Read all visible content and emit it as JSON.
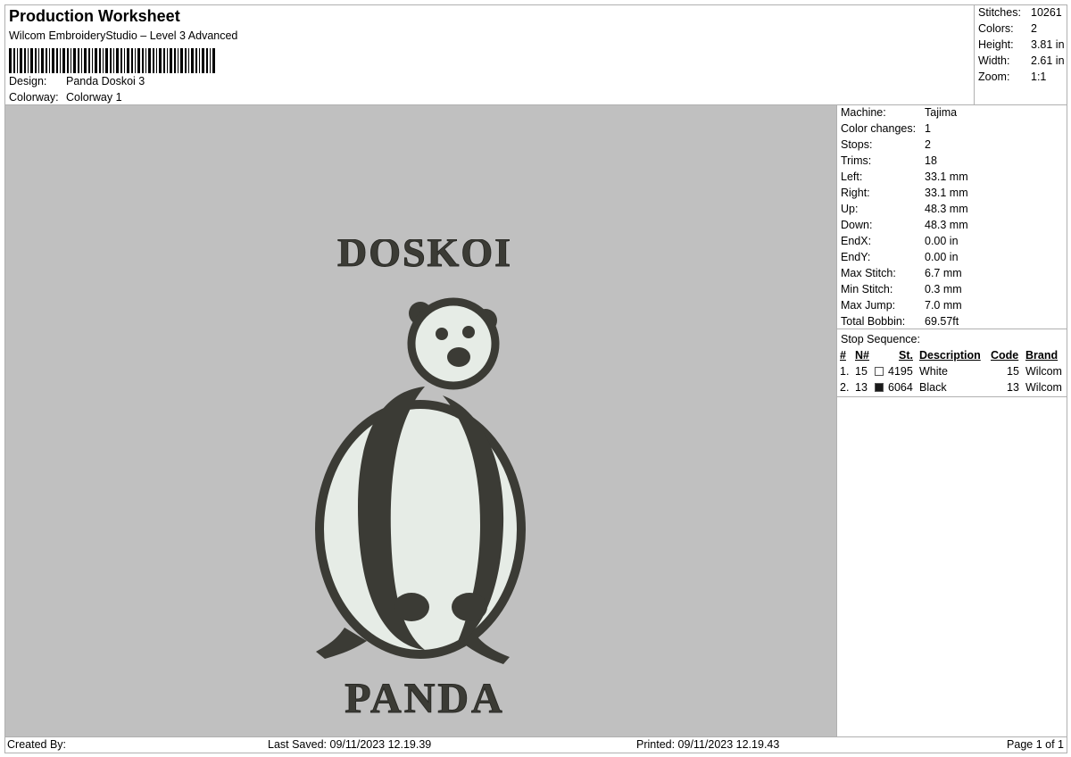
{
  "header": {
    "title": "Production Worksheet",
    "software": "Wilcom EmbroideryStudio – Level 3 Advanced",
    "design_label": "Design:",
    "design_value": "Panda Doskoi 3",
    "colorway_label": "Colorway:",
    "colorway_value": "Colorway 1"
  },
  "stats": {
    "stitches_label": "Stitches:",
    "stitches_value": "10261",
    "colors_label": "Colors:",
    "colors_value": "2",
    "height_label": "Height:",
    "height_value": "3.81 in",
    "width_label": "Width:",
    "width_value": "2.61 in",
    "zoom_label": "Zoom:",
    "zoom_value": "1:1"
  },
  "info": [
    {
      "label": "Machine:",
      "value": "Tajima"
    },
    {
      "label": "Color changes:",
      "value": "1"
    },
    {
      "label": "Stops:",
      "value": "2"
    },
    {
      "label": "Trims:",
      "value": "18"
    },
    {
      "label": "Left:",
      "value": "33.1 mm"
    },
    {
      "label": "Right:",
      "value": "33.1 mm"
    },
    {
      "label": "Up:",
      "value": "48.3 mm"
    },
    {
      "label": "Down:",
      "value": "48.3 mm"
    },
    {
      "label": "EndX:",
      "value": "0.00 in"
    },
    {
      "label": "EndY:",
      "value": "0.00 in"
    },
    {
      "label": "Max Stitch:",
      "value": "6.7 mm"
    },
    {
      "label": "Min Stitch:",
      "value": "0.3 mm"
    },
    {
      "label": "Max Jump:",
      "value": "7.0 mm"
    },
    {
      "label": "Total Bobbin:",
      "value": "69.57ft"
    }
  ],
  "stop_sequence": {
    "title": "Stop Sequence:",
    "headers": {
      "num": "#",
      "n": "N#",
      "st": "St.",
      "description": "Description",
      "code": "Code",
      "brand": "Brand"
    },
    "rows": [
      {
        "num": "1.",
        "n": "15",
        "st": "4195",
        "description": "White",
        "code": "15",
        "brand": "Wilcom",
        "swatch": "#ffffff"
      },
      {
        "num": "2.",
        "n": "13",
        "st": "6064",
        "description": "Black",
        "code": "13",
        "brand": "Wilcom",
        "swatch": "#1a1a1a"
      }
    ]
  },
  "design": {
    "top_text": "DOSKOI",
    "bottom_text": "PANDA",
    "thread_dark": "#3b3b35",
    "thread_light": "#e6ece6",
    "background": "#c0c0c0"
  },
  "footer": {
    "created_by": "Created By:",
    "last_saved": "Last Saved: 09/11/2023 12.19.39",
    "printed": "Printed: 09/11/2023 12.19.43",
    "page": "Page 1 of 1"
  }
}
